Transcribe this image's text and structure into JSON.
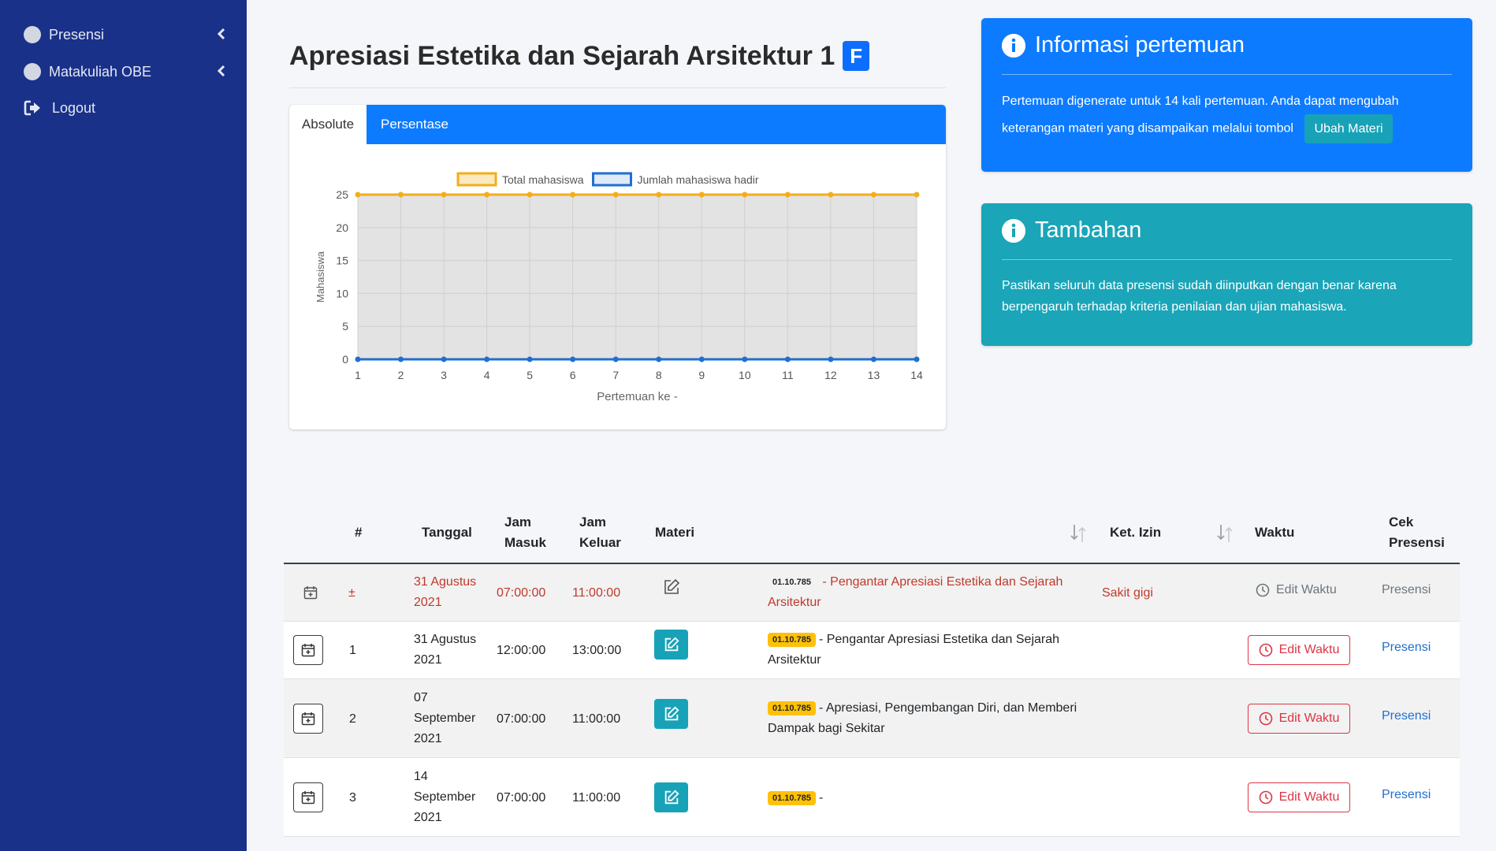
{
  "sidebar": {
    "items": [
      {
        "label": "Presensi"
      },
      {
        "label": "Matakuliah OBE"
      },
      {
        "label": "Logout"
      }
    ]
  },
  "header": {
    "title": "Apresiasi Estetika dan Sejarah Arsitektur 1",
    "class_badge": "F"
  },
  "chart_tabs": [
    "Absolute",
    "Persentase"
  ],
  "chart_data": {
    "type": "line",
    "x": [
      1,
      2,
      3,
      4,
      5,
      6,
      7,
      8,
      9,
      10,
      11,
      12,
      13,
      14
    ],
    "series": [
      {
        "name": "Total mahasiswa",
        "values": [
          25,
          25,
          25,
          25,
          25,
          25,
          25,
          25,
          25,
          25,
          25,
          25,
          25,
          25
        ],
        "color": "#f2ae1c"
      },
      {
        "name": "Jumlah mahasiswa hadir",
        "values": [
          0,
          0,
          0,
          0,
          0,
          0,
          0,
          0,
          0,
          0,
          0,
          0,
          0,
          0
        ],
        "color": "#1f6fd1"
      }
    ],
    "xlabel": "Pertemuan ke -",
    "ylabel": "Mahasiswa",
    "ylim": [
      0,
      25
    ],
    "yticks": [
      0,
      5,
      10,
      15,
      20,
      25
    ],
    "legend": "top",
    "grid": true
  },
  "info_cards": {
    "informasi": {
      "title": "Informasi pertemuan",
      "text": "Pertemuan digenerate untuk 14 kali pertemuan. Anda dapat mengubah keterangan materi yang disampaikan melalui tombol",
      "button": "Ubah Materi"
    },
    "tambahan": {
      "title": "Tambahan",
      "text": "Pastikan seluruh data presensi sudah diinputkan dengan benar karena berpengaruh terhadap kriteria penilaian dan ujian mahasiswa."
    }
  },
  "table": {
    "headers": {
      "no": "#",
      "tanggal": "Tanggal",
      "jam_masuk": "Jam Masuk",
      "jam_keluar": "Jam Keluar",
      "materi": "Materi",
      "ket_izin": "Ket. Izin",
      "waktu": "Waktu",
      "cek_presensi": "Cek Presensi"
    },
    "rows": [
      {
        "no": "±",
        "tanggal": "31 Agustus 2021",
        "jam_masuk": "07:00:00",
        "jam_keluar": "11:00:00",
        "code": "01.10.785",
        "materi": "Pengantar Apresiasi Estetika dan Sejarah Arsitektur",
        "ket_izin": "Sakit gigi",
        "waktu": "Edit Waktu",
        "cek": "Presensi"
      },
      {
        "no": "1",
        "tanggal": "31 Agustus 2021",
        "jam_masuk": "12:00:00",
        "jam_keluar": "13:00:00",
        "code": "01.10.785",
        "materi": "Pengantar Apresiasi Estetika dan Sejarah Arsitektur",
        "ket_izin": "",
        "waktu": "Edit Waktu",
        "cek": "Presensi"
      },
      {
        "no": "2",
        "tanggal": "07 September 2021",
        "jam_masuk": "07:00:00",
        "jam_keluar": "11:00:00",
        "code": "01.10.785",
        "materi": "Apresiasi, Pengembangan Diri, dan Memberi Dampak bagi Sekitar",
        "ket_izin": "",
        "waktu": "Edit Waktu",
        "cek": "Presensi"
      },
      {
        "no": "3",
        "tanggal": "14 September 2021",
        "jam_masuk": "07:00:00",
        "jam_keluar": "11:00:00",
        "code": "01.10.785",
        "materi": "",
        "ket_izin": "",
        "waktu": "Edit Waktu",
        "cek": "Presensi"
      }
    ]
  },
  "colors": {
    "sidebar": "#1a3189",
    "primary": "#0d7bff",
    "teal": "#1aa5b8",
    "danger": "#dc3545",
    "badge_yellow": "#ffc107"
  }
}
